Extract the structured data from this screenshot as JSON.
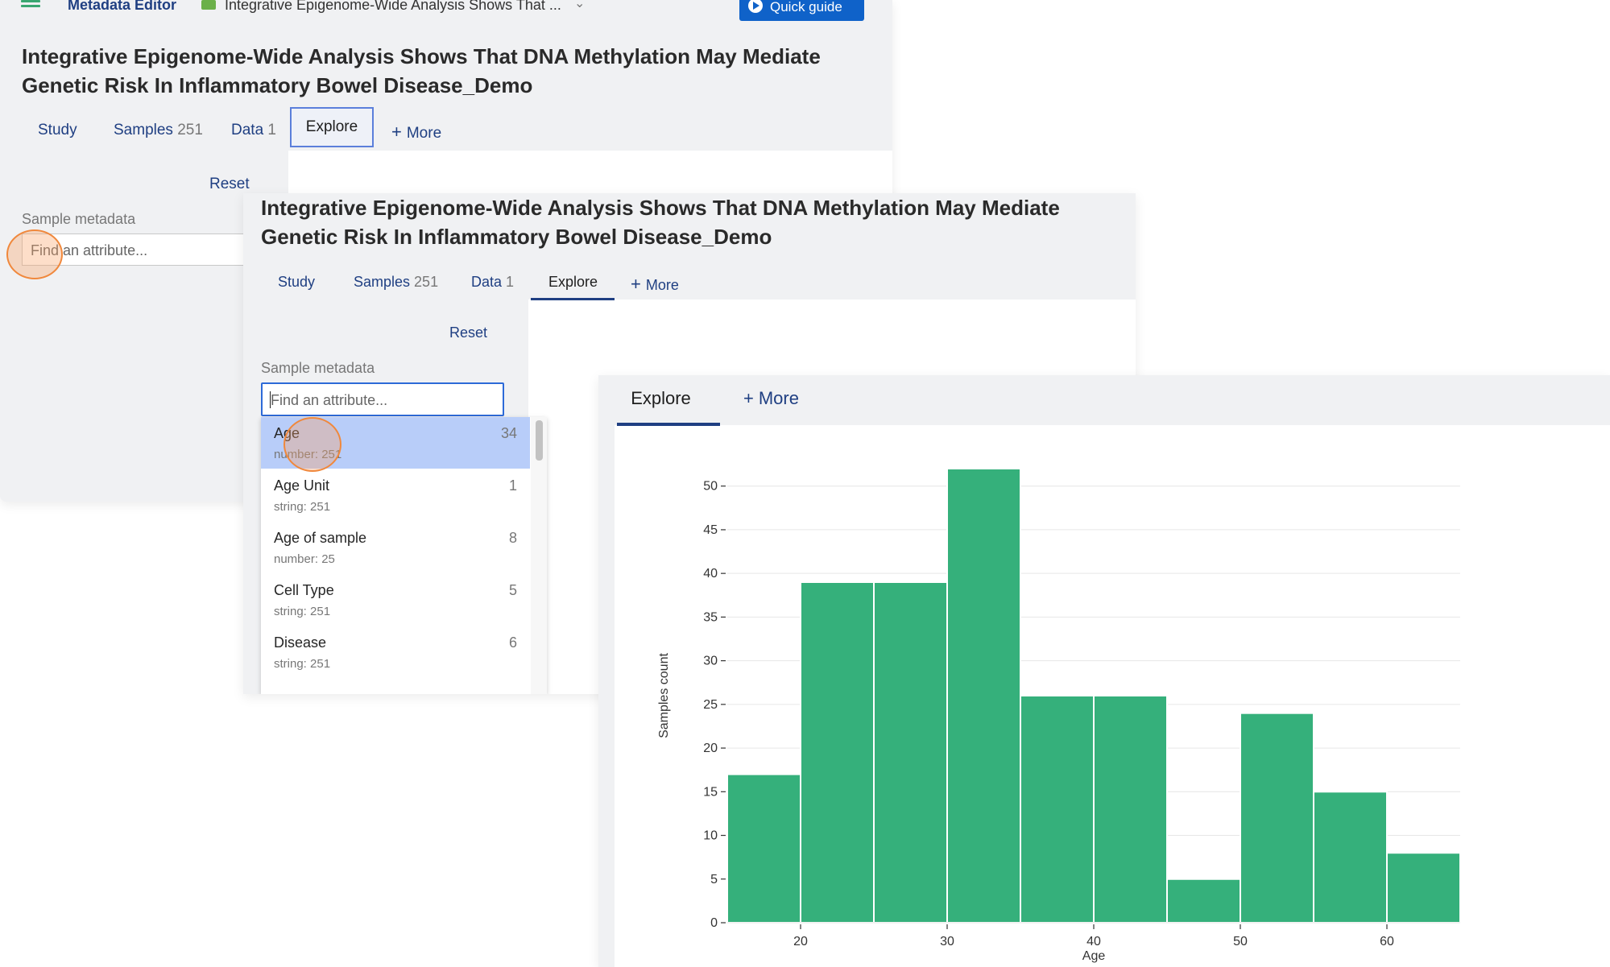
{
  "topbar": {
    "app_name": "Metadata Editor",
    "doc_title": "Integrative Epigenome-Wide Analysis Shows That ...",
    "quick_guide": "Quick guide"
  },
  "study": {
    "title": "Integrative Epigenome-Wide Analysis Shows That DNA Methylation May Mediate Genetic Risk In Inflammatory Bowel Disease_Demo"
  },
  "tabs": [
    {
      "label": "Study",
      "count": ""
    },
    {
      "label": "Samples",
      "count": "251"
    },
    {
      "label": "Data",
      "count": "1"
    },
    {
      "label": "Explore",
      "count": ""
    },
    {
      "label": "More",
      "count": ""
    }
  ],
  "sidebar": {
    "reset": "Reset",
    "section_label": "Sample metadata",
    "search_placeholder": "Find an attribute..."
  },
  "attributes": [
    {
      "name": "Age",
      "sub": "number: 251",
      "count": "34"
    },
    {
      "name": "Age Unit",
      "sub": "string: 251",
      "count": "1"
    },
    {
      "name": "Age of sample",
      "sub": "number: 25",
      "count": "8"
    },
    {
      "name": "Cell Type",
      "sub": "string: 251",
      "count": "5"
    },
    {
      "name": "Disease",
      "sub": "string: 251",
      "count": "6"
    }
  ],
  "colors": {
    "accent": "#1f3f82",
    "primary_button": "#0f62c9",
    "bar": "#35b07b",
    "selection": "#b8cdf9",
    "click_marker": "#f0883c"
  },
  "chart_data": {
    "type": "bar",
    "xlabel": "Age",
    "ylabel": "Samples count",
    "bin_edges": [
      15,
      20,
      25,
      30,
      35,
      40,
      45,
      50,
      55,
      60,
      65
    ],
    "values": [
      17,
      39,
      39,
      52,
      26,
      26,
      5,
      24,
      15,
      8
    ],
    "xticks": [
      20,
      30,
      40,
      50,
      60
    ],
    "yticks": [
      0,
      5,
      10,
      15,
      20,
      25,
      30,
      35,
      40,
      45,
      50
    ],
    "xlim": [
      15,
      65
    ],
    "ylim": [
      0,
      52
    ],
    "grid": true
  }
}
